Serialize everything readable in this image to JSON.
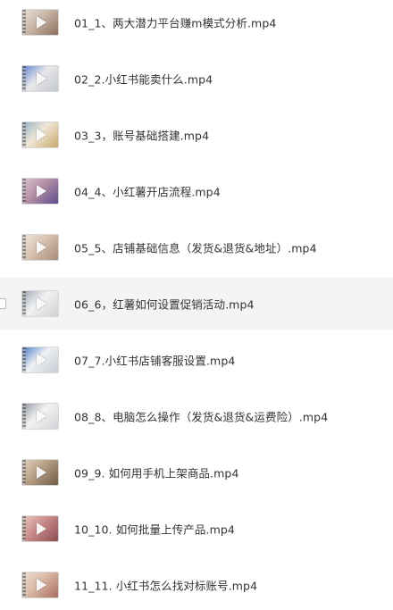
{
  "files": [
    {
      "name": "01_1、两大潜力平台赚m模式分析.mp4",
      "thumb_colors": [
        "#c9b7a8",
        "#8a6f5e",
        "#e9dfd6"
      ],
      "selected": false
    },
    {
      "name": "02_2.小红书能卖什么.mp4",
      "thumb_colors": [
        "#e8e8ea",
        "#c2c6cf",
        "#5b7fd0"
      ],
      "selected": false
    },
    {
      "name": "03_3，账号基础搭建.mp4",
      "thumb_colors": [
        "#efe7d8",
        "#c9a86a",
        "#8fb0c4"
      ],
      "selected": false
    },
    {
      "name": "04_4、小红薯开店流程.mp4",
      "thumb_colors": [
        "#b68fa6",
        "#5a4d8a",
        "#d9c4cf"
      ],
      "selected": false
    },
    {
      "name": "05_5、店铺基础信息（发货&退货&地址）.mp4",
      "thumb_colors": [
        "#d8c3b2",
        "#a88b77",
        "#f1e6dc"
      ],
      "selected": false
    },
    {
      "name": "06_6，红薯如何设置促销活动.mp4",
      "thumb_colors": [
        "#f2f2f2",
        "#d0d0d0",
        "#9aa6b4"
      ],
      "selected": true
    },
    {
      "name": "07_7.小红书店铺客服设置.mp4",
      "thumb_colors": [
        "#eef0f3",
        "#c7ccd4",
        "#4a78c9"
      ],
      "selected": false
    },
    {
      "name": "08_8、电脑怎么操作（发货&退货&运费险）.mp4",
      "thumb_colors": [
        "#f3f3f3",
        "#cfd2d6",
        "#8f969f"
      ],
      "selected": false
    },
    {
      "name": "09_9. 如何用手机上架商品.mp4",
      "thumb_colors": [
        "#b79f84",
        "#6e5b46",
        "#e2d4c2"
      ],
      "selected": false
    },
    {
      "name": "10_10. 如何批量上传产品.mp4",
      "thumb_colors": [
        "#c98a8a",
        "#8c4d52",
        "#e6c7b9"
      ],
      "selected": false
    },
    {
      "name": "11_11. 小红书怎么找对标账号.mp4",
      "thumb_colors": [
        "#d9b9a6",
        "#a86c5e",
        "#efe0d5"
      ],
      "selected": false
    }
  ]
}
